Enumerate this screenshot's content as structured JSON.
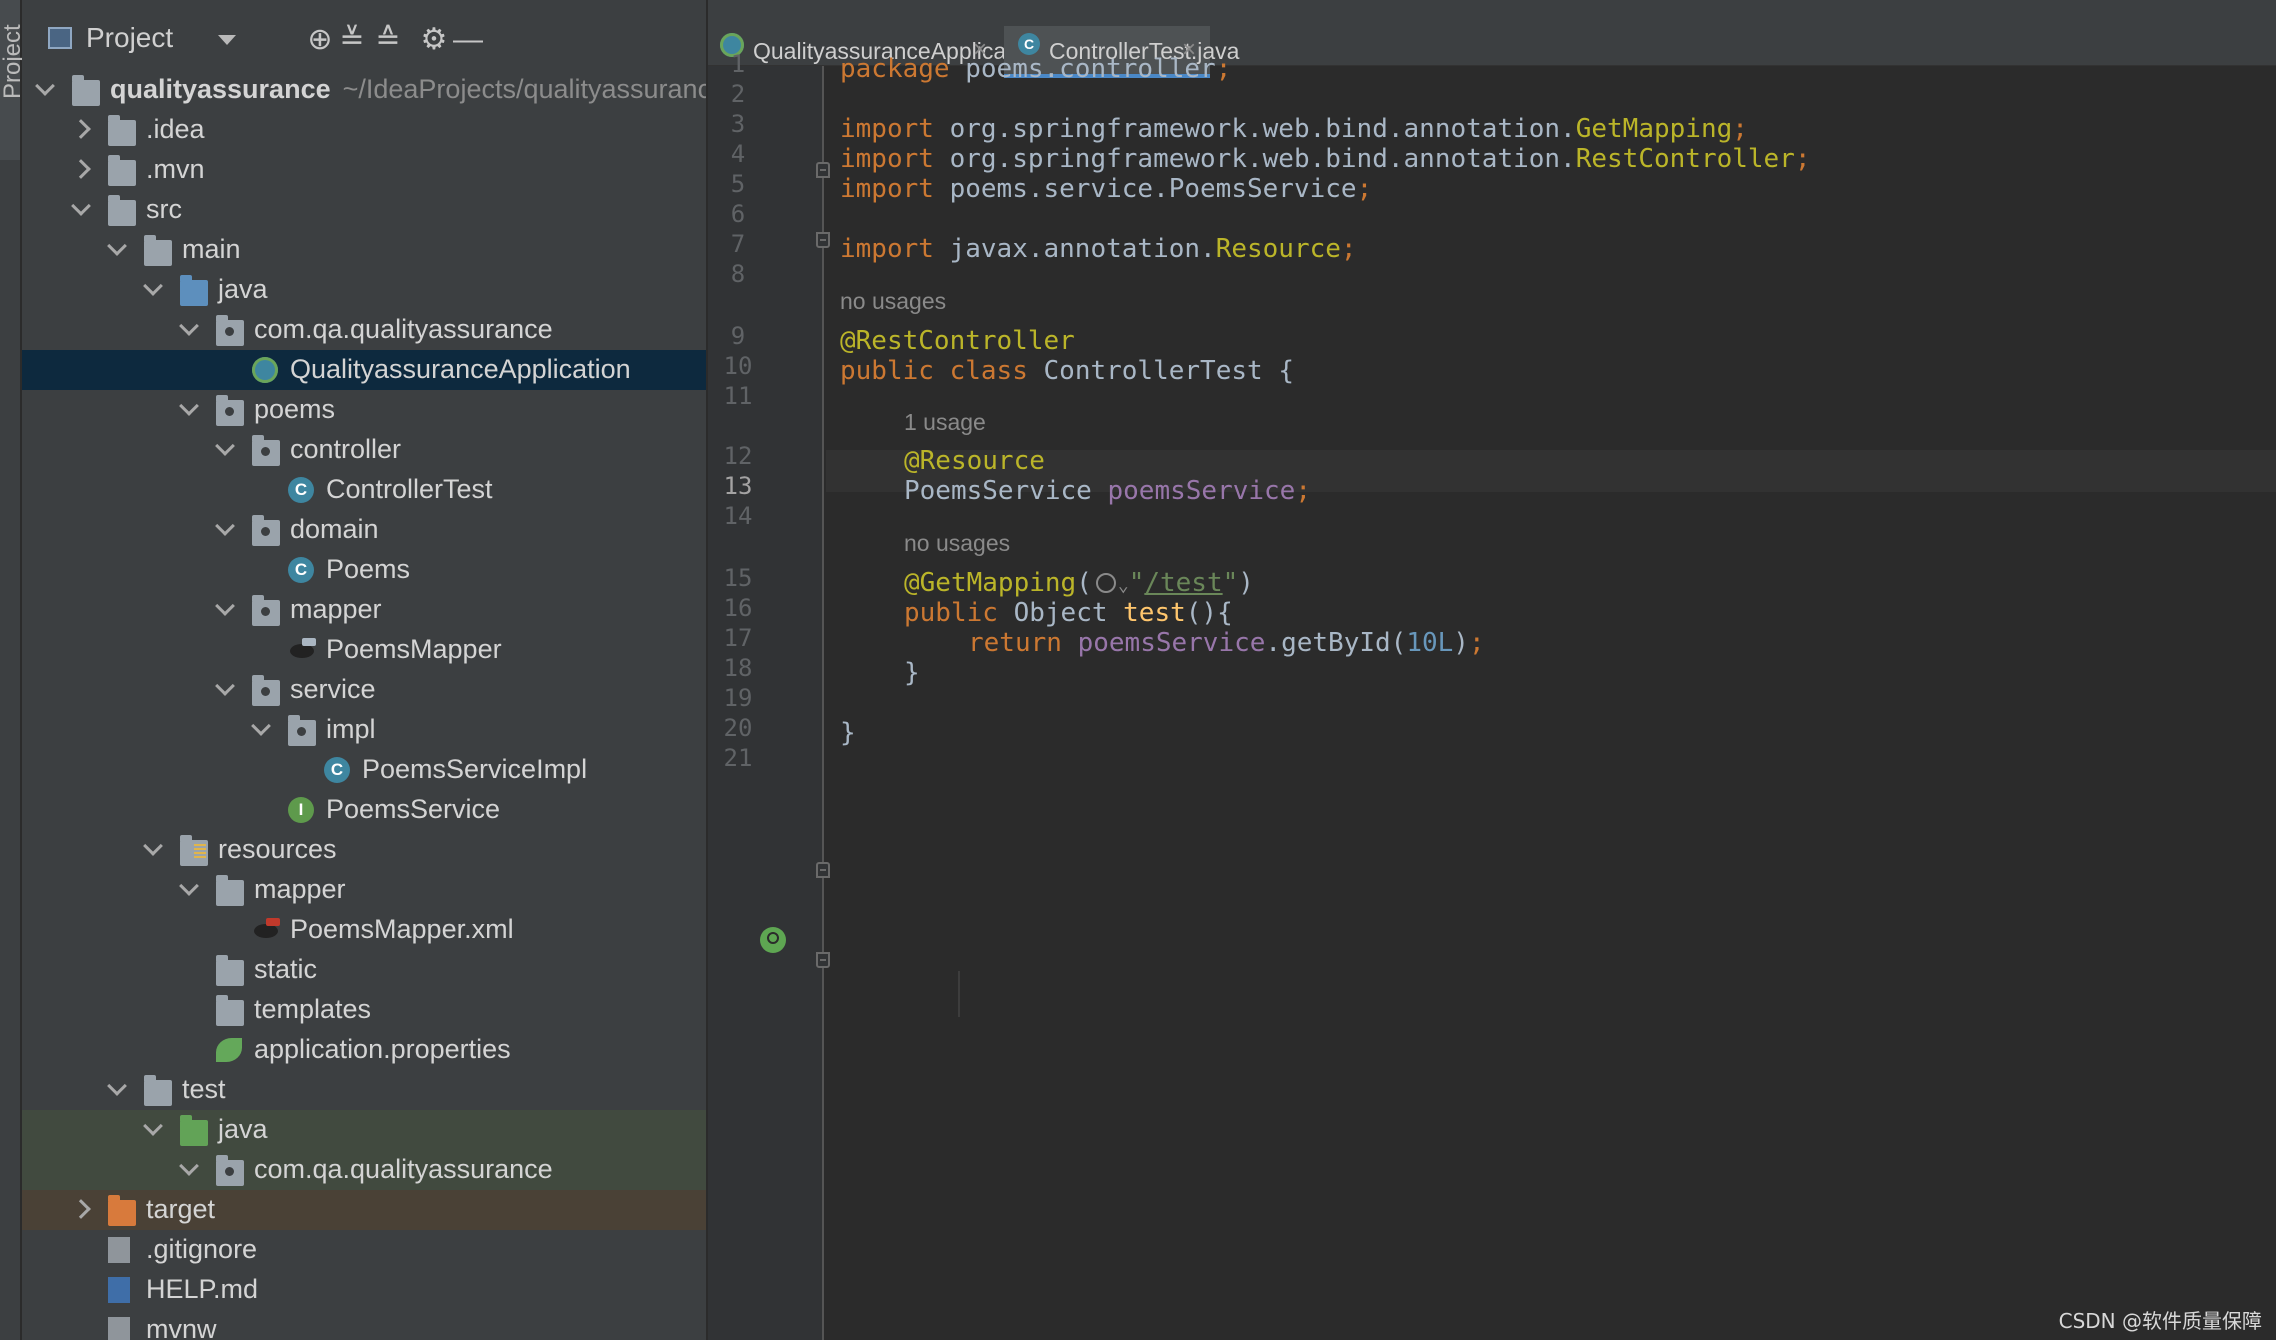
{
  "tool_strip": {
    "label": "Project"
  },
  "panel": {
    "title": "Project"
  },
  "tree": [
    {
      "label": "qualityassurance",
      "sub": "~/IdeaProjects/qualityassuranc",
      "indent": 0,
      "arrow": "down",
      "icon": "module-folder",
      "bold": true
    },
    {
      "label": ".idea",
      "indent": 1,
      "arrow": "right",
      "icon": "folder"
    },
    {
      "label": ".mvn",
      "indent": 1,
      "arrow": "right",
      "icon": "folder"
    },
    {
      "label": "src",
      "indent": 1,
      "arrow": "down",
      "icon": "folder"
    },
    {
      "label": "main",
      "indent": 2,
      "arrow": "down",
      "icon": "folder"
    },
    {
      "label": "java",
      "indent": 3,
      "arrow": "down",
      "icon": "source-folder"
    },
    {
      "label": "com.qa.qualityassurance",
      "indent": 4,
      "arrow": "down",
      "icon": "package"
    },
    {
      "label": "QualityassuranceApplication",
      "indent": 5,
      "icon": "spring-app-class",
      "selected": true
    },
    {
      "label": "poems",
      "indent": 4,
      "arrow": "down",
      "icon": "package"
    },
    {
      "label": "controller",
      "indent": 5,
      "arrow": "down",
      "icon": "package"
    },
    {
      "label": "ControllerTest",
      "indent": 6,
      "icon": "class"
    },
    {
      "label": "domain",
      "indent": 5,
      "arrow": "down",
      "icon": "package"
    },
    {
      "label": "Poems",
      "indent": 6,
      "icon": "class"
    },
    {
      "label": "mapper",
      "indent": 5,
      "arrow": "down",
      "icon": "package"
    },
    {
      "label": "PoemsMapper",
      "indent": 6,
      "icon": "mybatis"
    },
    {
      "label": "service",
      "indent": 5,
      "arrow": "down",
      "icon": "package"
    },
    {
      "label": "impl",
      "indent": 6,
      "arrow": "down",
      "icon": "package"
    },
    {
      "label": "PoemsServiceImpl",
      "indent": 7,
      "icon": "class"
    },
    {
      "label": "PoemsService",
      "indent": 6,
      "icon": "interface"
    },
    {
      "label": "resources",
      "indent": 3,
      "arrow": "down",
      "icon": "resources-folder"
    },
    {
      "label": "mapper",
      "indent": 4,
      "arrow": "down",
      "icon": "folder"
    },
    {
      "label": "PoemsMapper.xml",
      "indent": 5,
      "icon": "mybatis-xml"
    },
    {
      "label": "static",
      "indent": 4,
      "icon": "folder"
    },
    {
      "label": "templates",
      "indent": 4,
      "icon": "folder"
    },
    {
      "label": "application.properties",
      "indent": 4,
      "icon": "spring-properties"
    },
    {
      "label": "test",
      "indent": 2,
      "arrow": "down",
      "icon": "folder"
    },
    {
      "label": "java",
      "indent": 3,
      "arrow": "down",
      "icon": "test-folder",
      "bg": "test"
    },
    {
      "label": "com.qa.qualityassurance",
      "indent": 4,
      "arrow": "down",
      "icon": "package",
      "bg": "test"
    },
    {
      "label": "target",
      "indent": 1,
      "arrow": "right",
      "icon": "excluded-folder",
      "bg": "target"
    },
    {
      "label": ".gitignore",
      "indent": 1,
      "icon": "gitignore-file"
    },
    {
      "label": "HELP.md",
      "indent": 1,
      "icon": "markdown-file"
    },
    {
      "label": "mvnw",
      "indent": 1,
      "icon": "shell-file"
    }
  ],
  "tabs": [
    {
      "label": "QualityassuranceApplication.java",
      "icon": "spring-app-class",
      "active": false
    },
    {
      "label": "ControllerTest.java",
      "icon": "class",
      "active": true
    }
  ],
  "line_numbers": [
    "1",
    "2",
    "3",
    "4",
    "5",
    "6",
    "7",
    "8",
    "9",
    "10",
    "11",
    "12",
    "13",
    "14",
    "15",
    "16",
    "17",
    "18",
    "19",
    "20",
    "21"
  ],
  "current_line": "13",
  "code": {
    "l1_kw": "package",
    "l1_rest": " poems.controller",
    "semi": ";",
    "import_kw": "import",
    "l3_pkg": " org.springframework.web.bind.annotation.",
    "l3_cls": "GetMapping",
    "l4_pkg": " org.springframework.web.bind.annotation.",
    "l4_cls": "RestController",
    "l5_rest": " poems.service.PoemsService",
    "l7_pkg": " javax.annotation.",
    "l7_cls": "Resource",
    "hint_no_usages": "no usages",
    "l9_ann": "@RestController",
    "l10_kw1": "public",
    "l10_kw2": "class",
    "l10_name": " ControllerTest {",
    "hint_1_usage": "1 usage",
    "l12_ann": "@Resource",
    "l13_type": "PoemsService ",
    "l13_field": "poemsService",
    "l15_ann": "@GetMapping",
    "l15_open": "(",
    "l15_q": "\"",
    "l15_url": "/test",
    "l15_close": ")",
    "l16_kw": "public",
    "l16_type": " Object ",
    "l16_fn": "test",
    "l16_rest": "(){",
    "l17_kw": "return",
    "l17_field": "poemsService",
    "l17_call": ".getById(",
    "l17_num": "10L",
    "l17_close": ")",
    "l18": "}",
    "l20": "}"
  },
  "watermark": "CSDN @软件质量保障"
}
